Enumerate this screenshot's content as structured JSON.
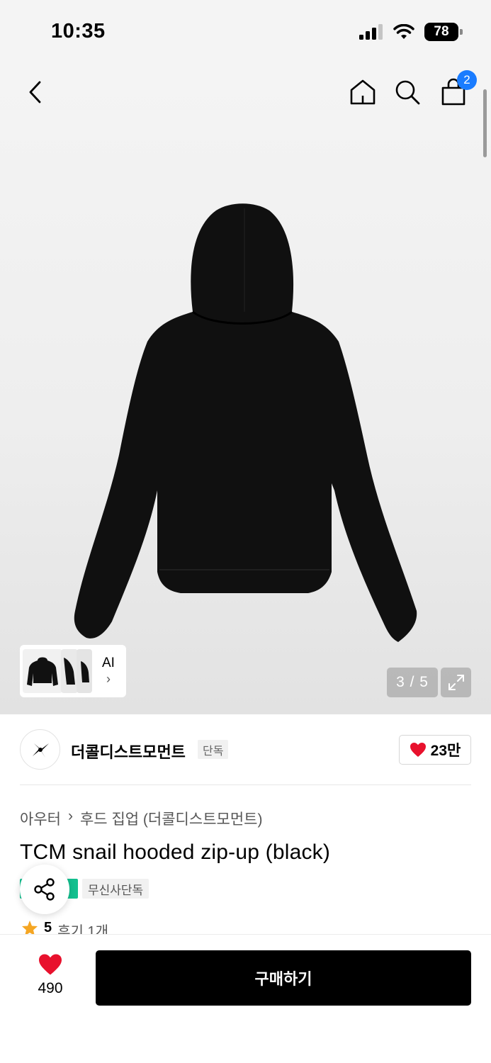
{
  "status_bar": {
    "time": "10:35",
    "battery": "78"
  },
  "header": {
    "back_icon": "chevron-left-icon",
    "home_icon": "home-icon",
    "search_icon": "search-icon",
    "cart_icon": "shopping-bag-icon",
    "cart_count": "2"
  },
  "gallery": {
    "ai_label": "AI",
    "page_counter": "3 / 5",
    "expand_icon": "expand-icon"
  },
  "brand": {
    "name": "더콜디스트모먼트",
    "tag": "단독",
    "likes": "23만"
  },
  "product": {
    "breadcrumb": [
      "아우터",
      "후드 집업 (더콜디스트모먼트)"
    ],
    "title": "TCM snail hooded zip-up (black)",
    "tags": [
      "무신사단독"
    ],
    "rating": "5",
    "reviews": "후기 1개"
  },
  "bottom_bar": {
    "wish_count": "490",
    "buy_label": "구매하기"
  },
  "colors": {
    "accent_blue": "#1a7cff",
    "heart_red": "#e8112d",
    "tag_green": "#12c08f",
    "star_orange": "#f5a623"
  }
}
